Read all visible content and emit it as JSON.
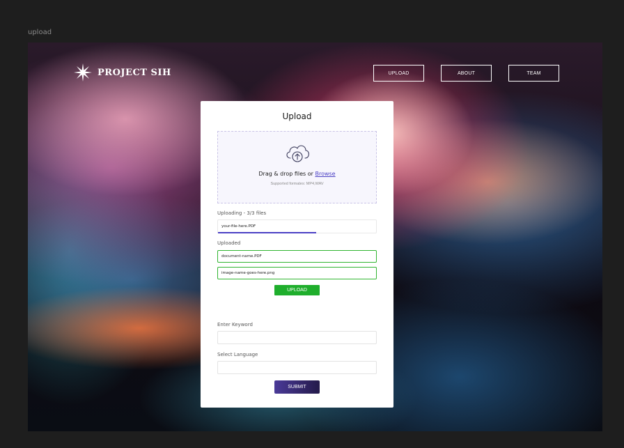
{
  "frame": {
    "label": "upload"
  },
  "brand": {
    "name": "PROJECT SIH",
    "icon": "starburst-icon"
  },
  "nav": {
    "items": [
      {
        "label": "UPLOAD"
      },
      {
        "label": "ABOUT"
      },
      {
        "label": "TEAM"
      }
    ]
  },
  "card": {
    "title": "Upload",
    "dropzone": {
      "icon": "cloud-upload-icon",
      "text": "Drag & drop files or ",
      "browse_label": "Browse",
      "formats": "Supported formates: MP4,WAV"
    },
    "uploading": {
      "label": "Uploading - 3/3 files",
      "file_name": "your-file-here.PDF",
      "progress": 0.62
    },
    "uploaded": {
      "label": "Uploaded",
      "files": [
        {
          "name": "document-name.PDF"
        },
        {
          "name": "image-name-goes-here.png"
        }
      ]
    },
    "upload_button": "UPLOAD",
    "keyword": {
      "label": "Enter Keyword",
      "value": "",
      "placeholder": ""
    },
    "language": {
      "label": "Select Language",
      "value": "",
      "placeholder": ""
    },
    "submit_button": "SUBMIT"
  },
  "colors": {
    "accent": "#4a3fc4",
    "success": "#1fae2c",
    "submit_start": "#4a3a98",
    "submit_end": "#241a4a"
  }
}
